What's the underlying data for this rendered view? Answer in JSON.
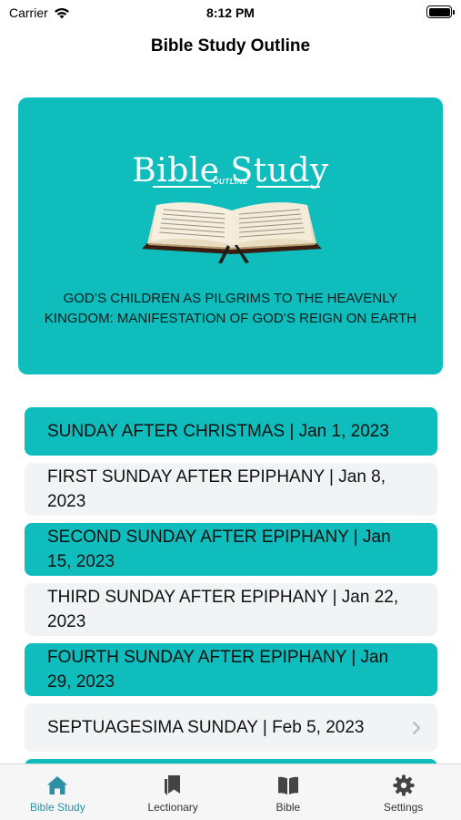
{
  "status_bar": {
    "carrier": "Carrier",
    "time": "8:12 PM"
  },
  "nav": {
    "title": "Bible Study Outline"
  },
  "banner": {
    "logo_title": "Bible Study",
    "logo_subtitle": "OUTLINE",
    "theme_text": "GOD’S CHILDREN AS PILGRIMS TO THE HEAVENLY KINGDOM: MANIFESTATION OF GOD’S REIGN ON EARTH"
  },
  "studies": [
    {
      "label": "SUNDAY AFTER CHRISTMAS | Jan 1, 2023"
    },
    {
      "label": "FIRST SUNDAY AFTER EPIPHANY | Jan 8, 2023"
    },
    {
      "label": "SECOND SUNDAY AFTER EPIPHANY | Jan 15, 2023"
    },
    {
      "label": "THIRD SUNDAY AFTER EPIPHANY | Jan 22, 2023"
    },
    {
      "label": "FOURTH SUNDAY AFTER EPIPHANY | Jan 29, 2023"
    },
    {
      "label": "SEPTUAGESIMA SUNDAY | Feb 5, 2023"
    }
  ],
  "tabs": [
    {
      "label": "Bible Study",
      "icon": "home-icon",
      "active": true
    },
    {
      "label": "Lectionary",
      "icon": "bookmarks-icon",
      "active": false
    },
    {
      "label": "Bible",
      "icon": "open-book-icon",
      "active": false
    },
    {
      "label": "Settings",
      "icon": "gear-icon",
      "active": false
    }
  ],
  "colors": {
    "accent": "#0fbdbd",
    "row_alt": "#f2f3f5",
    "tab_active": "#2f8fa4"
  }
}
